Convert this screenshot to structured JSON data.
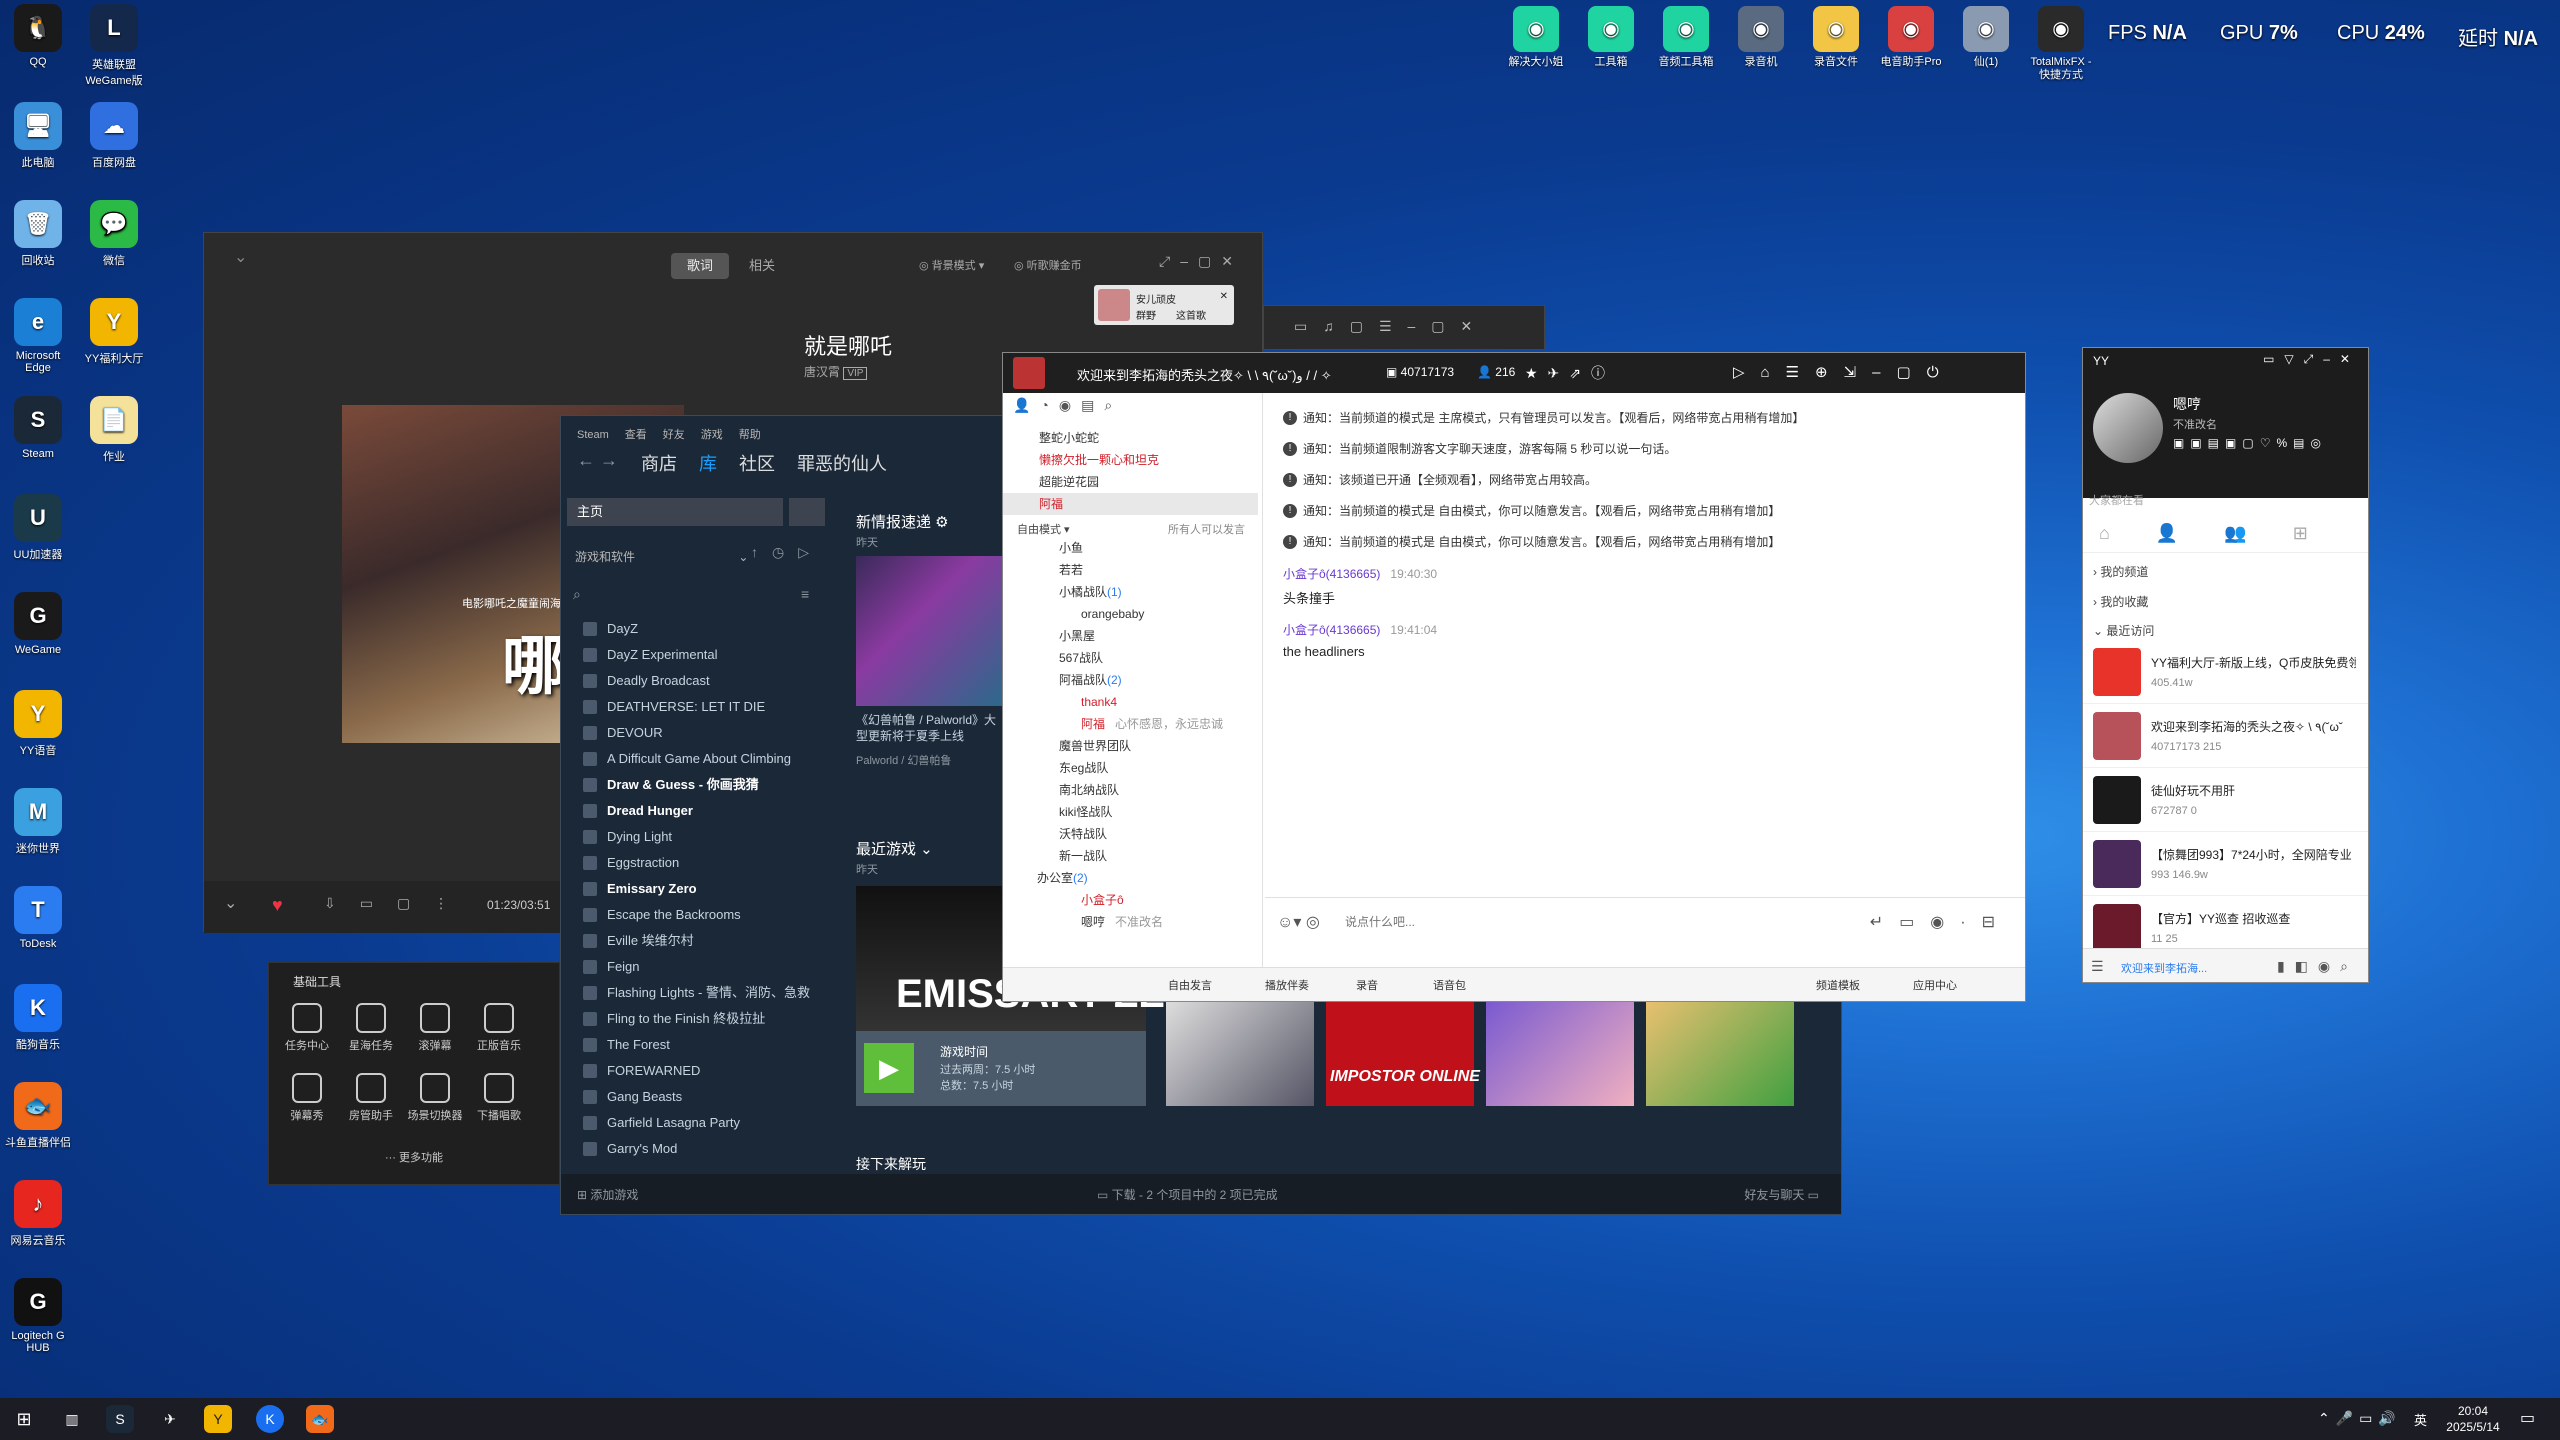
{
  "desktop": {
    "left_icons": [
      {
        "label": "QQ",
        "color": "#1a1a1a",
        "glyph": "🐧"
      },
      {
        "label": "英雄联盟WeGame版",
        "color": "#13284a",
        "glyph": "L"
      },
      {
        "label": "此电脑",
        "color": "#3a8fd9",
        "glyph": "🖥"
      },
      {
        "label": "百度网盘",
        "color": "#2f6fe0",
        "glyph": "☁"
      },
      {
        "label": "回收站",
        "color": "#6fb3e8",
        "glyph": "🗑"
      },
      {
        "label": "微信",
        "color": "#2bba45",
        "glyph": "💬"
      },
      {
        "label": "Microsoft Edge",
        "color": "#1b7fd6",
        "glyph": "e"
      },
      {
        "label": "YY福利大厅",
        "color": "#f2b600",
        "glyph": "Y"
      },
      {
        "label": "Steam",
        "color": "#1b2838",
        "glyph": "S"
      },
      {
        "label": "作业",
        "color": "#f5e29a",
        "glyph": "📄"
      },
      {
        "label": "UU加速器",
        "color": "#1a3a4a",
        "glyph": "U"
      },
      {
        "label": "WeGame",
        "color": "#1a1a1a",
        "glyph": "G"
      },
      {
        "label": "YY语音",
        "color": "#f2b600",
        "glyph": "Y"
      },
      {
        "label": "迷你世界",
        "color": "#3aa0e0",
        "glyph": "M"
      },
      {
        "label": "ToDesk",
        "color": "#2a7cf0",
        "glyph": "T"
      },
      {
        "label": "酷狗音乐",
        "color": "#1a6ff0",
        "glyph": "K"
      },
      {
        "label": "斗鱼直播伴侣",
        "color": "#f06a1a",
        "glyph": "🐟"
      },
      {
        "label": "网易云音乐",
        "color": "#e6261f",
        "glyph": "♪"
      },
      {
        "label": "Logitech G HUB",
        "color": "#111111",
        "glyph": "G"
      }
    ],
    "top_icons": [
      {
        "label": "解决大小姐",
        "color": "#1fd4a0"
      },
      {
        "label": "工具箱",
        "color": "#1fd4a0"
      },
      {
        "label": "音频工具箱",
        "color": "#1fd4a0"
      },
      {
        "label": "录音机",
        "color": "#5a6a80"
      },
      {
        "label": "录音文件",
        "color": "#f2c644"
      },
      {
        "label": "电音助手Pro",
        "color": "#d94040"
      },
      {
        "label": "仙(1)",
        "color": "#8a9ab0"
      },
      {
        "label": "TotalMixFX - 快捷方式",
        "color": "#2a2a2a"
      }
    ],
    "perf": {
      "fps_label": "FPS",
      "fps_value": "N/A",
      "gpu_label": "GPU",
      "gpu_value": "7",
      "cpu_label": "CPU",
      "cpu_value": "24",
      "lat_label": "延时",
      "lat_value": "N/A",
      "pct": "%"
    }
  },
  "music": {
    "tab_lyrics": "歌词",
    "tab_related": "相关",
    "bg_mode": "背景模式",
    "listen_coin": "听歌赚金币",
    "song_title": "就是哪吒",
    "artist": "唐汉霄",
    "vip": "VIP",
    "poster_text": "哪吒",
    "poster_sub": "电影哪吒之魔童闹海",
    "time": "01:23/03:51",
    "notif_title": "安儿顽皮",
    "notif_sub1": "群野",
    "notif_sub2": "这首歌",
    "toolbox_title": "基础工具",
    "tools": [
      "任务中心",
      "星海任务",
      "滚弹幕",
      "正版音乐",
      "弹幕秀",
      "房管助手",
      "场景切换器",
      "下播唱歌"
    ],
    "more": "更多功能"
  },
  "steam": {
    "menu": [
      "Steam",
      "查看",
      "好友",
      "游戏",
      "帮助"
    ],
    "nav": [
      "商店",
      "库",
      "社区",
      "罪恶的仙人"
    ],
    "home": "主页",
    "filter": "游戏和软件",
    "games": [
      "DayZ",
      "DayZ Experimental",
      "Deadly Broadcast",
      "DEATHVERSE: LET IT DIE",
      "DEVOUR",
      "A Difficult Game About Climbing",
      "Draw & Guess - 你画我猜",
      "Dread Hunger",
      "Dying Light",
      "Eggstraction",
      "Emissary Zero",
      "Escape the Backrooms",
      "Eville 埃维尔村",
      "Feign",
      "Flashing Lights - 警情、消防、急救",
      "Fling to the Finish 終极拉扯",
      "The Forest",
      "FOREWARNED",
      "Gang Beasts",
      "Garfield Lasagna Party",
      "Garry's Mod"
    ],
    "bold_games": [
      "Draw & Guess - 你画我猜",
      "Dread Hunger",
      "Emissary Zero"
    ],
    "news_title": "新情报速递",
    "news_when": "昨天",
    "news_caption": "《幻兽帕鲁 / Palworld》大型更新将于夏季上线",
    "news_source": "Palworld / 幻兽帕鲁",
    "recent_title": "最近游戏",
    "recent_when": "昨天",
    "emissary": "EMISSARY ZERO",
    "play_label": "游戏时间",
    "play_two_weeks": "过去两周：7.5 小时",
    "play_total": "总数：7.5 小时",
    "impostor": "IMPOSTOR ONLINE",
    "section3": "接下来解玩",
    "add_game": "添加游戏",
    "download": "下载 - 2 个项目中的 2 项已完成",
    "friends": "好友与聊天"
  },
  "yy": {
    "title": "欢迎来到李拓海的秃头之夜✧ \\ \\ ٩(˘ω˘)و / / ✧",
    "channel_id": "40717173",
    "online": "216",
    "mode": "自由模式",
    "speak": "所有人可以发言",
    "channels_top": [
      "整蛇小蛇蛇",
      "懒擦欠批一颗心和坦克",
      "超能逆花园",
      "阿福"
    ],
    "channels": [
      {
        "name": "小鱼",
        "indent": 1
      },
      {
        "name": "若若",
        "indent": 1
      },
      {
        "name": "小橘战队",
        "count": "(1)",
        "indent": 1
      },
      {
        "name": "orangebaby",
        "indent": 2
      },
      {
        "name": "小黑屋",
        "indent": 1
      },
      {
        "name": "567战队",
        "indent": 1
      },
      {
        "name": "阿福战队",
        "count": "(2)",
        "indent": 1
      },
      {
        "name": "thank4",
        "indent": 2
      },
      {
        "name": "阿福",
        "note": "心怀感恩，永远忠诚",
        "indent": 2
      },
      {
        "name": "魔兽世界团队",
        "indent": 1
      },
      {
        "name": "东eg战队",
        "indent": 1
      },
      {
        "name": "南北纳战队",
        "indent": 1
      },
      {
        "name": "kiki怪战队",
        "indent": 1
      },
      {
        "name": "沃特战队",
        "indent": 1
      },
      {
        "name": "新一战队",
        "indent": 1
      },
      {
        "name": "办公室",
        "count": "(2)",
        "indent": 0
      },
      {
        "name": "小盒子ô",
        "indent": 2
      },
      {
        "name": "嗯哼",
        "note": "不准改名",
        "indent": 2
      }
    ],
    "notices": [
      "通知：当前频道的模式是 主席模式，只有管理员可以发言。【观看后，网络带宽占用稍有增加】",
      "通知：当前频道限制游客文字聊天速度，游客每隔 5 秒可以说一句话。",
      "通知：该频道已开通【全频观看】，网络带宽占用较高。",
      "通知：当前频道的模式是 自由模式，你可以随意发言。【观看后，网络带宽占用稍有增加】",
      "通知：当前频道的模式是 自由模式，你可以随意发言。【观看后，网络带宽占用稍有增加】"
    ],
    "messages": [
      {
        "user": "小盒子ô(4136665)",
        "time": "19:40:30",
        "text": "头条撞手"
      },
      {
        "user": "小盒子ô(4136665)",
        "time": "19:41:04",
        "text": "the headliners"
      }
    ],
    "input_placeholder": "说点什么吧...",
    "bottom": [
      "自由发言",
      "播放伴奏",
      "录音",
      "语音包",
      "频道模板",
      "应用中心"
    ]
  },
  "yyp": {
    "title": "YY",
    "name": "嗯哼",
    "status": "不准改名",
    "watching": "大家都在看",
    "my_channels": "我的频道",
    "my_fav": "我的收藏",
    "recent": "最近访问",
    "recents": [
      {
        "t1": "YY福利大厅-新版上线，Q币皮肤免费领",
        "t2": "405.41w",
        "color": "#e8332a"
      },
      {
        "t1": "欢迎来到李拓海的秃头之夜✧ \\ ٩(˘ω˘",
        "t2": "40717173   215",
        "color": "#b8525a"
      },
      {
        "t1": "徒仙好玩不用肝",
        "t2": "672787   0",
        "color": "#1a1a1a"
      },
      {
        "t1": "【惊舞团993】7*24小时，全网陪专业",
        "t2": "993   146.9w",
        "color": "#4a2a5a"
      },
      {
        "t1": "【官方】YY巡查 招收巡查",
        "t2": "11   25",
        "color": "#6a1a2a"
      }
    ],
    "footer": "欢迎来到李拓海..."
  },
  "taskbar": {
    "time": "20:04",
    "date": "2025/5/14",
    "ime": "英"
  }
}
